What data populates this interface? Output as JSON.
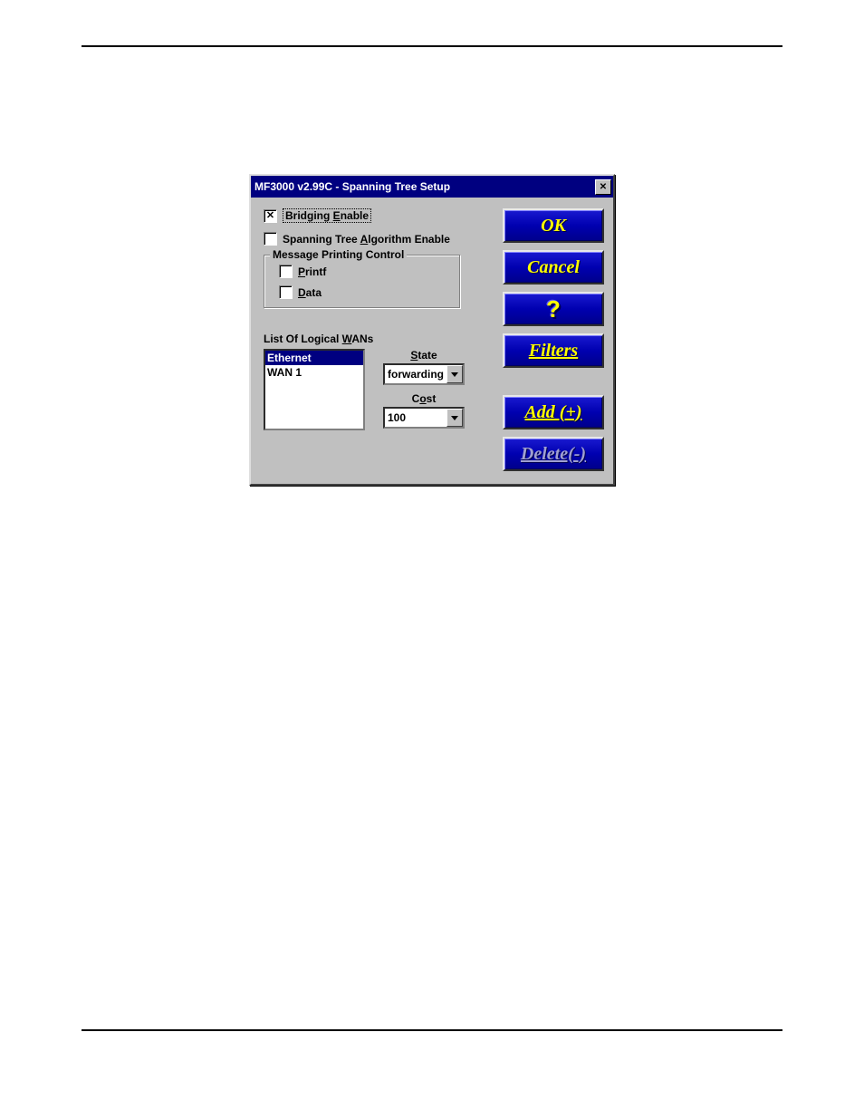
{
  "window": {
    "title": "MF3000 v2.99C - Spanning Tree Setup"
  },
  "checks": {
    "bridging": {
      "label_pre": "Bridging ",
      "label_u": "E",
      "label_post": "nable",
      "checked": "✕"
    },
    "spt": {
      "label_pre": "Spanning Tree ",
      "label_u": "A",
      "label_post": "lgorithm Enable",
      "checked": ""
    }
  },
  "group": {
    "legend": "Message Printing Control",
    "printf": {
      "label_u": "P",
      "label_post": "rintf",
      "checked": ""
    },
    "data": {
      "label_u": "D",
      "label_post": "ata",
      "checked": ""
    }
  },
  "wans": {
    "heading_pre": "List Of Logical ",
    "heading_u": "W",
    "heading_post": "ANs",
    "items": [
      {
        "label": "Ethernet",
        "selected": true
      },
      {
        "label": "WAN 1",
        "selected": false
      }
    ],
    "state": {
      "label_u": "S",
      "label_post": "tate",
      "value": "forwarding"
    },
    "cost": {
      "label_pre": "C",
      "label_u": "o",
      "label_post": "st",
      "value": "100"
    }
  },
  "buttons": {
    "ok": "OK",
    "cancel": "Cancel",
    "help": "?",
    "filters": "Filters",
    "add": "Add (+)",
    "delete": "Delete(-)"
  }
}
